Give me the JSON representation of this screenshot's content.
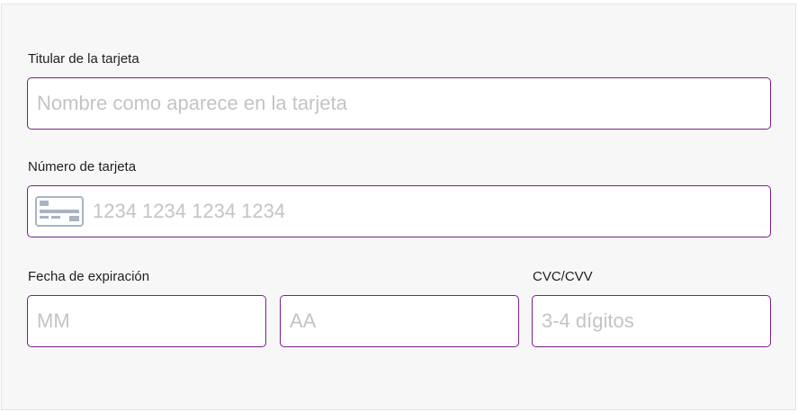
{
  "form": {
    "cardholder": {
      "label": "Titular de la tarjeta",
      "placeholder": "Nombre como aparece en la tarjeta",
      "value": ""
    },
    "card_number": {
      "label": "Número de tarjeta",
      "placeholder": "1234 1234 1234 1234",
      "value": "",
      "icon": "credit-card-icon"
    },
    "expiry": {
      "label": "Fecha de expiración",
      "month_placeholder": "MM",
      "year_placeholder": "AA",
      "month_value": "",
      "year_value": ""
    },
    "cvc": {
      "label": "CVC/CVV",
      "placeholder": "3-4 dígitos",
      "value": ""
    }
  },
  "colors": {
    "field_border": "#7a1f8c",
    "placeholder": "#c4c4c4",
    "panel_background": "#f7f7f7"
  }
}
